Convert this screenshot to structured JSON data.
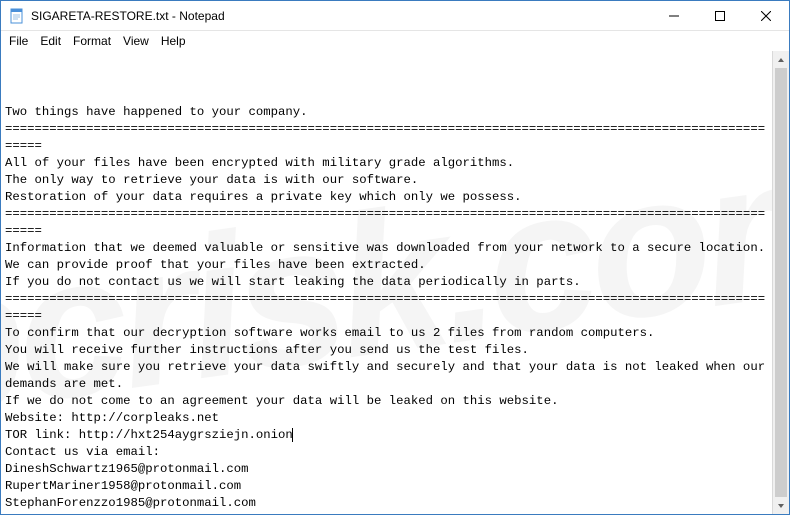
{
  "titlebar": {
    "title": "SIGARETA-RESTORE.txt - Notepad",
    "icon_name": "notepad-icon"
  },
  "window_controls": {
    "minimize": "minimize",
    "maximize": "maximize",
    "close": "close"
  },
  "menubar": {
    "items": [
      "File",
      "Edit",
      "Format",
      "View",
      "Help"
    ]
  },
  "watermark": "pcrisk.com",
  "document": {
    "lines": [
      "Two things have happened to your company.",
      "============================================================================================================",
      "All of your files have been encrypted with military grade algorithms.",
      "The only way to retrieve your data is with our software.",
      "Restoration of your data requires a private key which only we possess.",
      "============================================================================================================",
      "Information that we deemed valuable or sensitive was downloaded from your network to a secure location.",
      "We can provide proof that your files have been extracted.",
      "If you do not contact us we will start leaking the data periodically in parts.",
      "============================================================================================================",
      "To confirm that our decryption software works email to us 2 files from random computers.",
      "You will receive further instructions after you send us the test files.",
      "We will make sure you retrieve your data swiftly and securely and that your data is not leaked when our demands are met.",
      "If we do not come to an agreement your data will be leaked on this website.",
      "",
      "Website: http://corpleaks.net",
      "TOR link: http://hxt254aygrsziejn.onion",
      "",
      "Contact us via email:",
      "DineshSchwartz1965@protonmail.com",
      "RupertMariner1958@protonmail.com",
      "StephanForenzzo1985@protonmail.com"
    ],
    "caret_after_line_index": 16
  }
}
